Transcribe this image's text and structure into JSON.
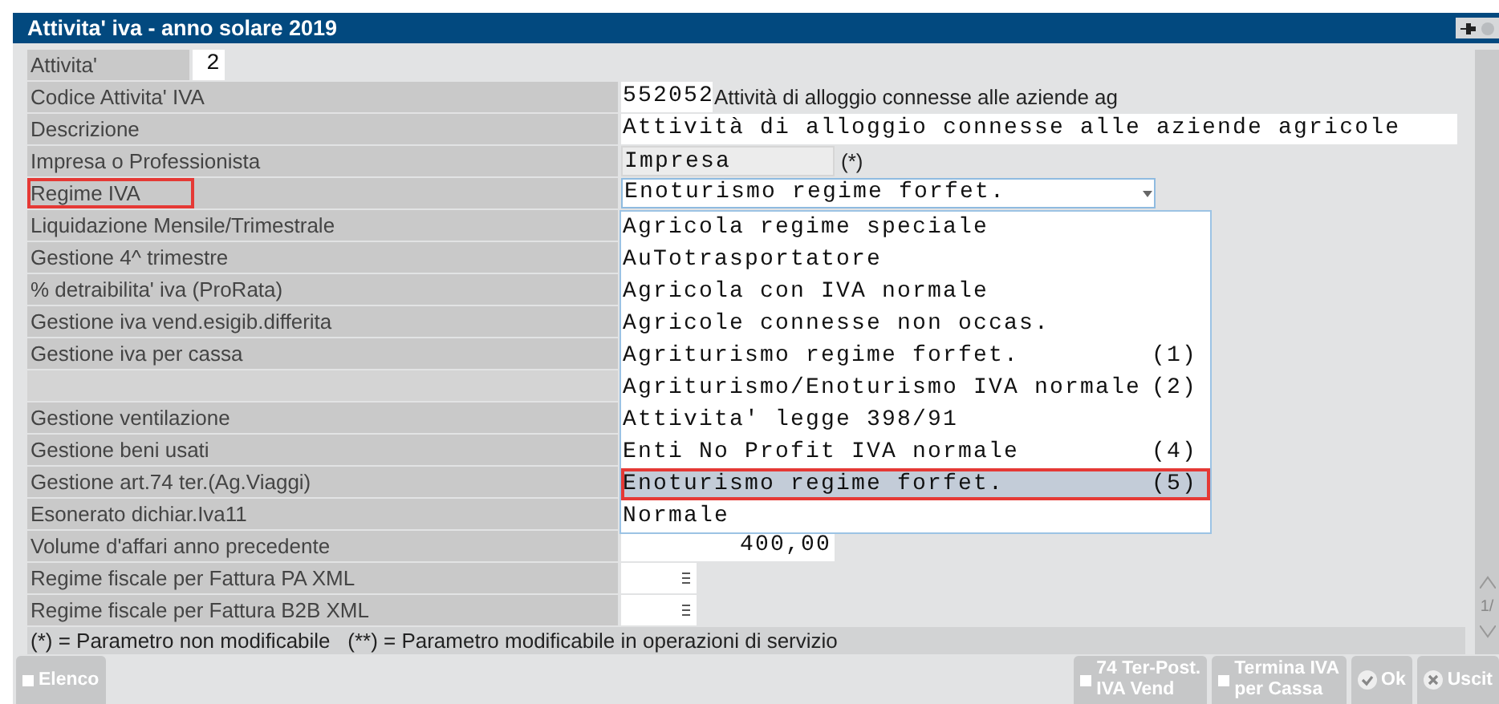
{
  "window": {
    "title": "Attivita' iva - anno solare 2019"
  },
  "fields": [
    {
      "label": "Attivita'",
      "kind": "short",
      "value": "2",
      "highlighted": false
    },
    {
      "label": "Codice Attivita' IVA",
      "kind": "code",
      "value": "552052",
      "note": "Attività di alloggio connesse alle aziende ag",
      "highlighted": false
    },
    {
      "label": "Descrizione",
      "kind": "text",
      "value": "Attività di alloggio connesse alle aziende agricole",
      "highlighted": false
    },
    {
      "label": "Impresa o Professionista",
      "kind": "readonly",
      "value": "Impresa",
      "note": "(*)",
      "highlighted": false
    },
    {
      "label": "Regime IVA",
      "kind": "dropdown",
      "value": "Enoturismo regime forfet.",
      "highlighted": true
    },
    {
      "label": "Liquidazione Mensile/Trimestrale",
      "kind": "covered",
      "highlighted": false
    },
    {
      "label": "Gestione 4^ trimestre",
      "kind": "covered",
      "highlighted": false
    },
    {
      "label": "% detraibilita' iva (ProRata)",
      "kind": "covered",
      "highlighted": false
    },
    {
      "label": "Gestione iva vend.esigib.differita",
      "kind": "covered",
      "highlighted": false
    },
    {
      "label": "Gestione iva per cassa",
      "kind": "covered",
      "highlighted": false
    },
    {
      "kind": "blank",
      "highlighted": false
    },
    {
      "label": "Gestione ventilazione",
      "kind": "covered",
      "highlighted": false
    },
    {
      "label": "Gestione beni usati",
      "kind": "covered",
      "highlighted": false
    },
    {
      "label": "Gestione art.74 ter.(Ag.Viaggi)",
      "kind": "covered",
      "highlighted": false
    },
    {
      "label": "Esonerato dichiar.Iva11",
      "kind": "covered",
      "highlighted": false
    },
    {
      "label": "Volume d'affari anno precedente",
      "kind": "number",
      "value": "400,00",
      "highlighted": false
    },
    {
      "label": "Regime fiscale per Fattura PA XML",
      "kind": "lookup",
      "highlighted": false
    },
    {
      "label": "Regime fiscale per Fattura B2B XML",
      "kind": "lookup",
      "highlighted": false
    }
  ],
  "regime_dropdown": {
    "options": [
      {
        "label": "Agricola regime speciale",
        "selected": false
      },
      {
        "label": "AuTotrasportatore",
        "selected": false
      },
      {
        "label": "Agricola con IVA normale",
        "selected": false
      },
      {
        "label": "Agricole connesse non occas.",
        "selected": false
      },
      {
        "label": "Agriturismo regime forfet.",
        "shortcut": "(1)",
        "selected": false
      },
      {
        "label": "Agriturismo/Enoturismo IVA normale",
        "shortcut": "(2)",
        "selected": false
      },
      {
        "label": "Attivita' legge 398/91",
        "selected": false
      },
      {
        "label": "Enti No Profit IVA normale",
        "shortcut": "(4)",
        "selected": false
      },
      {
        "label": "Enoturismo regime forfet.",
        "shortcut": "(5)",
        "selected": true
      },
      {
        "label": "Normale",
        "selected": false
      }
    ]
  },
  "footnote": "(*) = Parametro non modificabile   (**) = Parametro modificabile in operazioni di servizio",
  "page_indicator": "1/",
  "buttons": [
    {
      "label": "Elenco",
      "disabled": true,
      "kind": "plain"
    },
    {
      "label": "74 Ter-Post.\nIVA Vend",
      "disabled": true,
      "kind": "plain"
    },
    {
      "label": "Termina IVA\nper Cassa",
      "disabled": true,
      "kind": "plain"
    },
    {
      "label": "Ok",
      "disabled": true,
      "kind": "confirm"
    },
    {
      "label": "Uscit",
      "disabled": true,
      "kind": "exit"
    }
  ]
}
